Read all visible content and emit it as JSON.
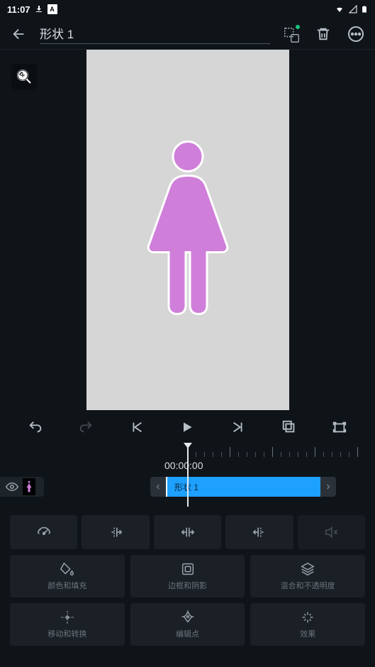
{
  "status": {
    "time": "11:07",
    "badge": "A"
  },
  "header": {
    "title": "形状 1"
  },
  "timeline": {
    "time": "00:00:00",
    "clip_label": "形状 1"
  },
  "panels": {
    "color_fill": "颜色和填充",
    "border_shadow": "边框和阴影",
    "blend_opacity": "混合和不透明度",
    "move_transform": "移动和转换",
    "edit_points": "编辑点",
    "effects": "效果"
  }
}
